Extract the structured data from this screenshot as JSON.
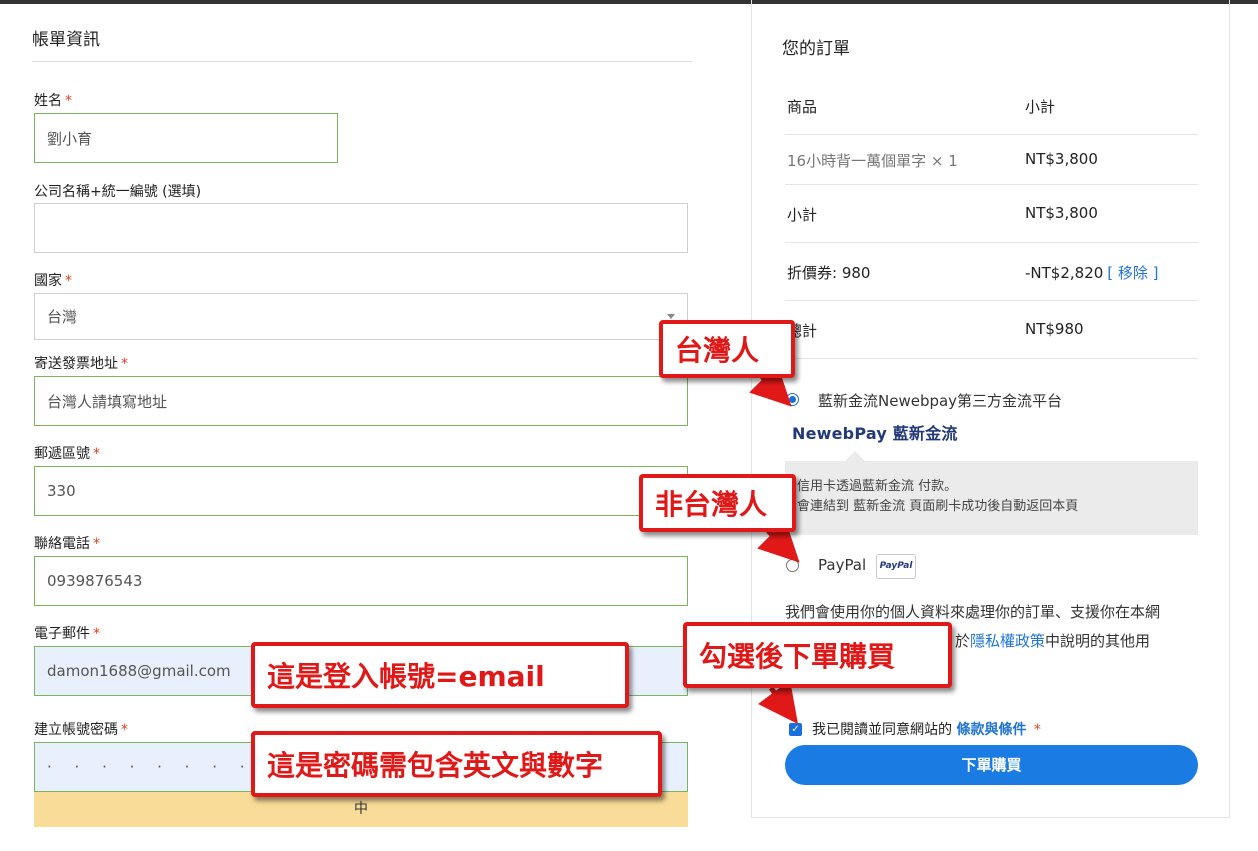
{
  "billing": {
    "title": "帳單資訊",
    "name_label": "姓名",
    "name_value": "劉小育",
    "company_label": "公司名稱+統一編號 (選填)",
    "company_value": "",
    "country_label": "國家",
    "country_value": "台灣",
    "address_label": "寄送發票地址",
    "address_placeholder": "台灣人請填寫地址",
    "zip_label": "郵遞區號",
    "zip_value": "330",
    "phone_label": "聯絡電話",
    "phone_value": "0939876543",
    "email_label": "電子郵件",
    "email_value": "damon1688@gmail.com",
    "password_label": "建立帳號密碼",
    "password_value": "· · · · · · · · · · · ·",
    "strength_label": "中",
    "required_mark": "*"
  },
  "order": {
    "title": "您的訂單",
    "col_product": "商品",
    "col_subtotal": "小計",
    "item_name": "16小時背一萬個單字 × 1",
    "item_price": "NT$3,800",
    "subtotal_label": "小計",
    "subtotal_value": "NT$3,800",
    "coupon_label": "折價券: 980",
    "coupon_value": "-NT$2,820",
    "coupon_remove": "[ 移除 ]",
    "total_label": "總計",
    "total_value": "NT$980"
  },
  "payment": {
    "newebpay_label": "藍新金流Newebpay第三方金流平台",
    "newebpay_logo": "NewebPay 藍新金流",
    "newebpay_desc_1": "信用卡透過藍新金流 付款。",
    "newebpay_desc_2": "會連結到 藍新金流 頁面刷卡成功後自動返回本頁",
    "paypal_label": "PayPal",
    "paypal_badge": "PayPal",
    "privacy_text_1": "我們會使用你的個人資料來處理你的訂單、支援你在本網",
    "privacy_text_2": "於",
    "privacy_link": "隱私權政策",
    "privacy_text_3": "中說明的其他用",
    "terms_text": "我已閱讀並同意網站的",
    "terms_link": "條款與條件",
    "terms_required": "*",
    "place_order": "下單購買"
  },
  "annotations": {
    "taiwan": "台灣人",
    "non_taiwan": "非台灣人",
    "checkout": "勾選後下單購買",
    "email_note": "這是登入帳號=email",
    "password_note": "這是密碼需包含英文與數字"
  },
  "colors": {
    "accent": "#1a7be3",
    "annotation_red": "#e01818",
    "valid_border": "#7ab55c",
    "strength_medium": "#f8dc97"
  }
}
